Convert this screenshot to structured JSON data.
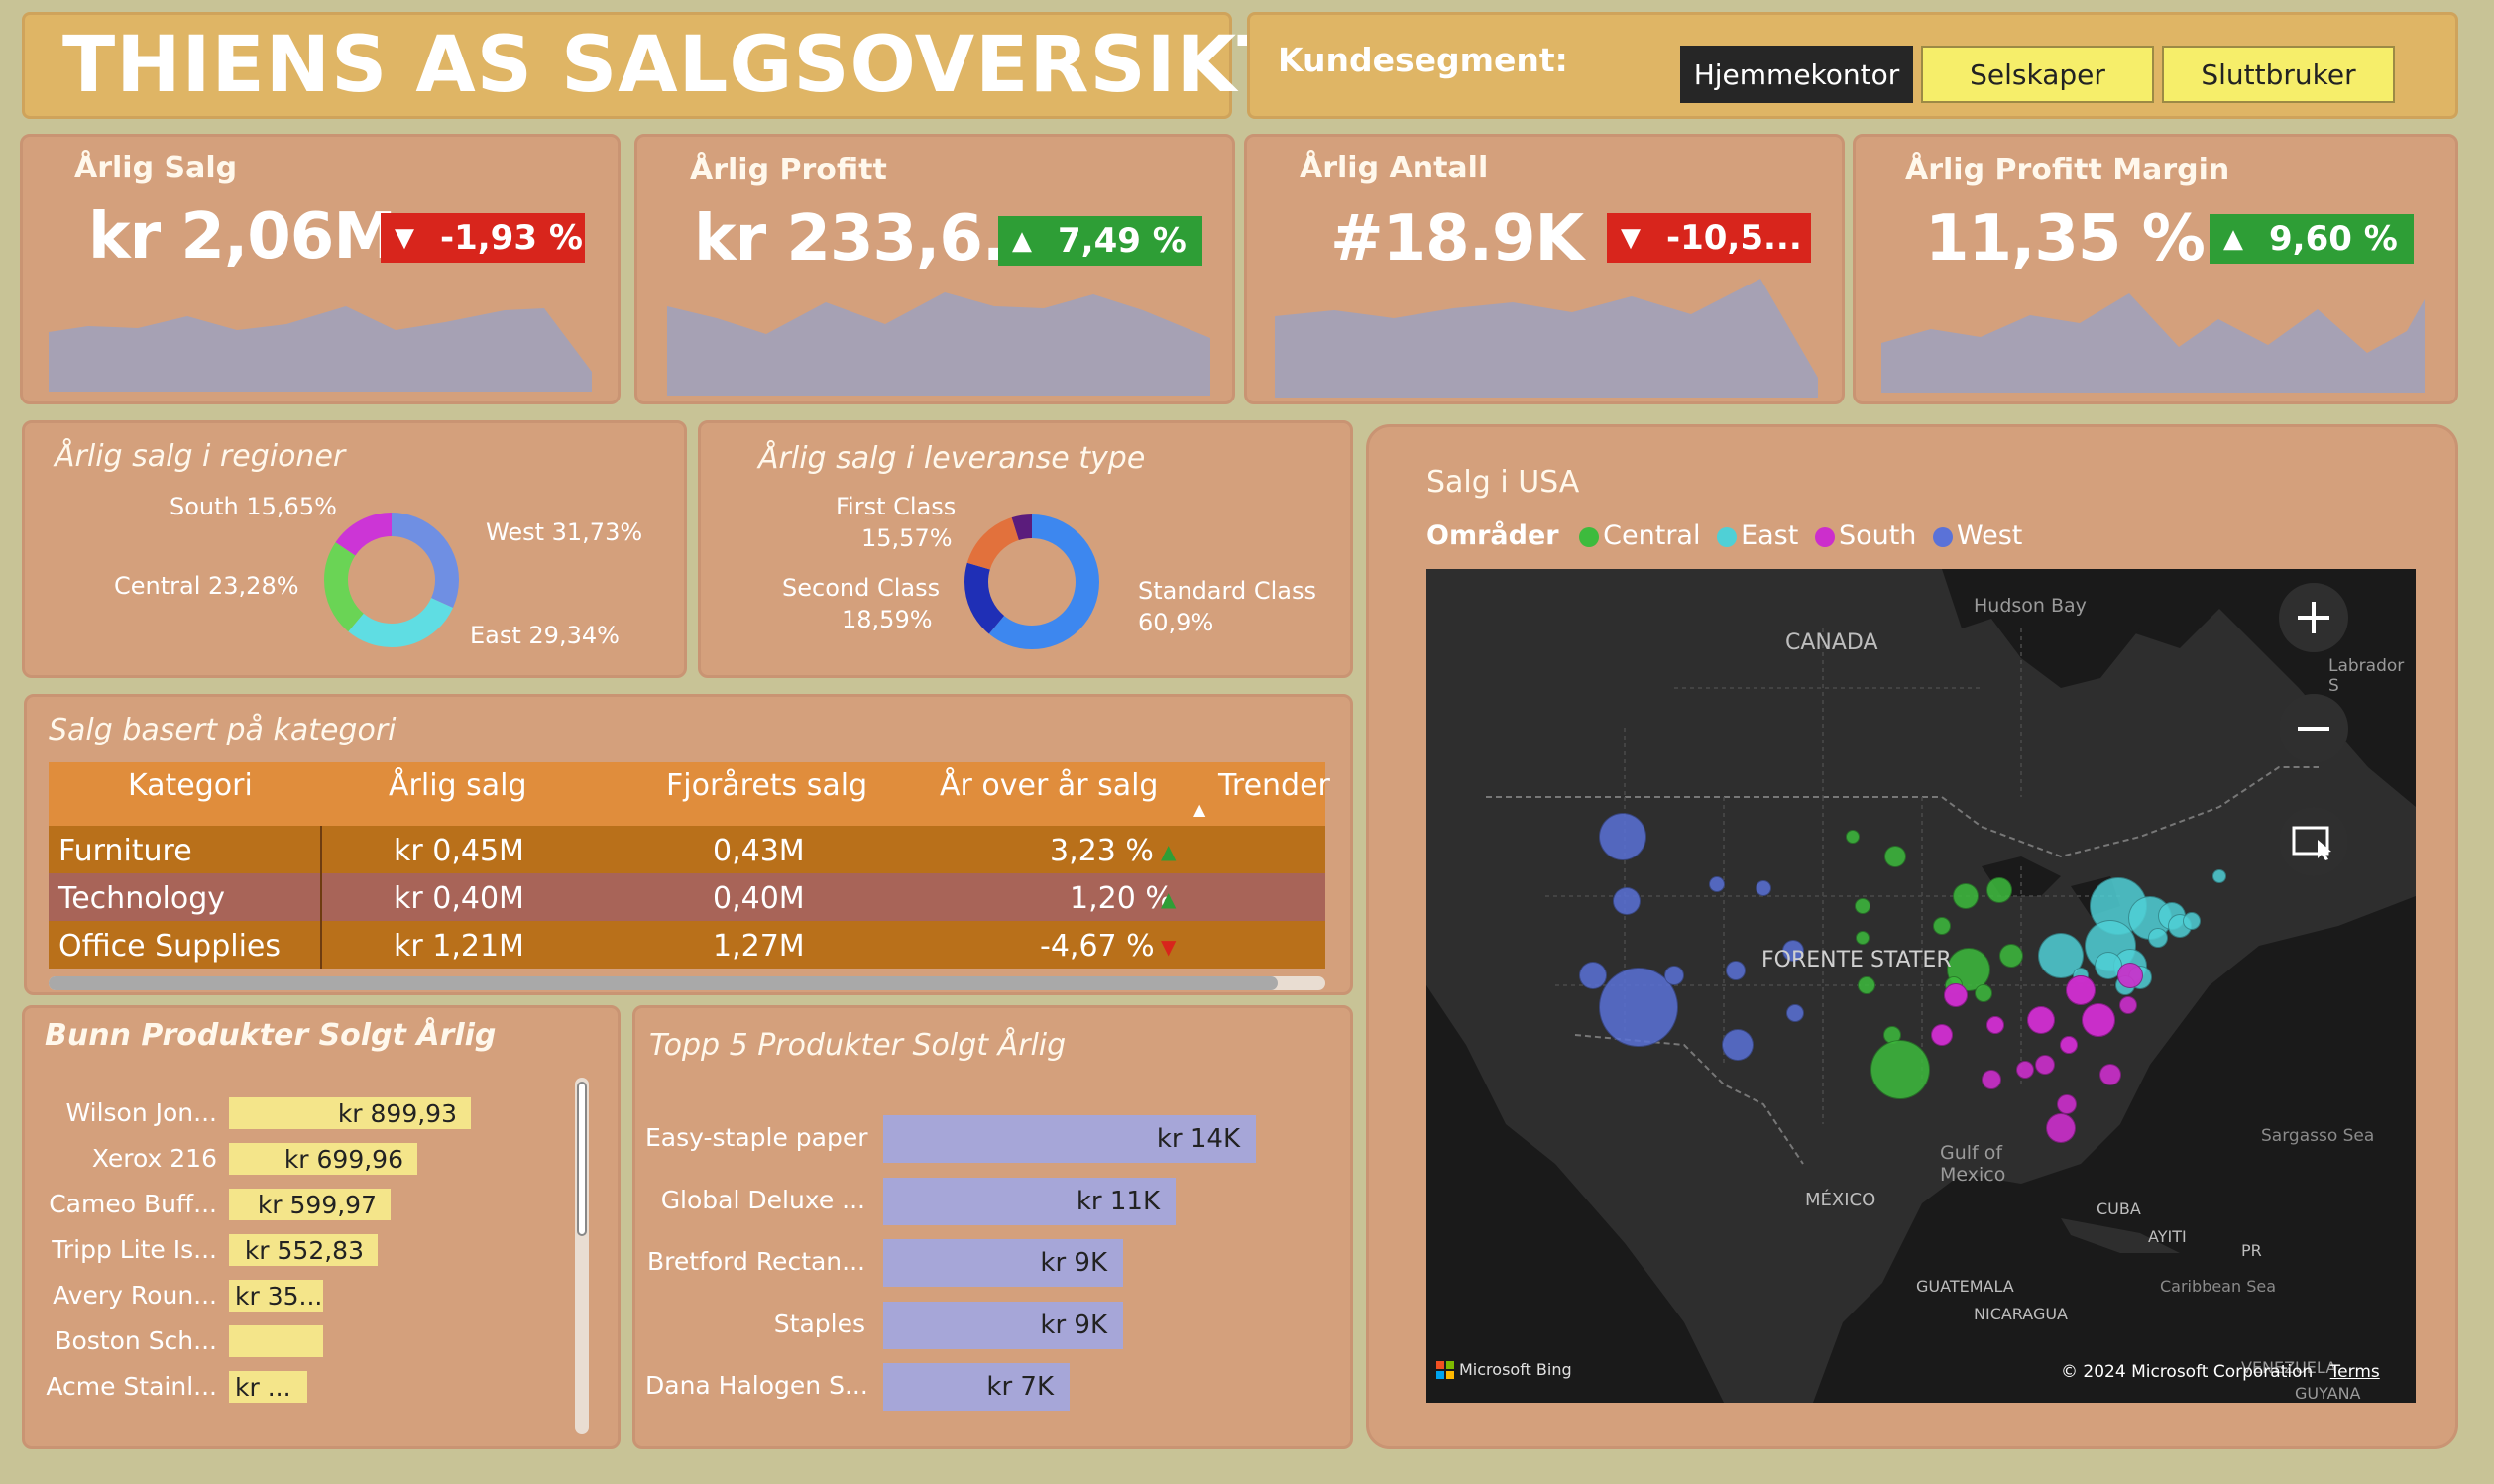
{
  "header": {
    "title": "THIENS AS SALGSOVERSIKT"
  },
  "segment": {
    "label": "Kundesegment:",
    "buttons": [
      "Hjemmekontor",
      "Selskaper",
      "Sluttbruker"
    ],
    "active": "Hjemmekontor"
  },
  "kpis": [
    {
      "title": "Årlig Salg",
      "value": "kr 2,06M",
      "change": "-1,93 %",
      "direction": "down"
    },
    {
      "title": "Årlig Profitt",
      "value": "kr 233,6...",
      "change": "7,49 %",
      "direction": "up"
    },
    {
      "title": "Årlig Antall",
      "value": "#18.9K",
      "change": "-10,5...",
      "direction": "down"
    },
    {
      "title": "Årlig Profitt Margin",
      "value": "11,35 %",
      "change": "9,60 %",
      "direction": "up"
    }
  ],
  "regions": {
    "title": "Årlig salg i regioner",
    "labels": [
      "South 15,65%",
      "West 31,73%",
      "Central 23,28%",
      "East 29,34%"
    ]
  },
  "shipping": {
    "title": "Årlig salg i leveranse type",
    "first_name": "First Class",
    "first_pct": "15,57%",
    "second_name": "Second Class",
    "second_pct": "18,59%",
    "standard_name": "Standard Class",
    "standard_pct": "60,9%"
  },
  "category_table": {
    "title": "Salg basert på kategori",
    "headers": [
      "Kategori",
      "Årlig salg",
      "Fjorårets salg",
      "År over år salg",
      "Trender"
    ],
    "rows": [
      {
        "category": "Furniture",
        "sales": "kr 0,45M",
        "last_year": "0,43M",
        "yoy": "3,23 %",
        "trend": "up"
      },
      {
        "category": "Technology",
        "sales": "kr 0,40M",
        "last_year": "0,40M",
        "yoy": "1,20 %",
        "trend": "up"
      },
      {
        "category": "Office Supplies",
        "sales": "kr 1,21M",
        "last_year": "1,27M",
        "yoy": "-4,67 %",
        "trend": "down"
      }
    ]
  },
  "bottom_products": {
    "title": "Bunn Produkter Solgt Årlig",
    "items": [
      {
        "name": "Wilson Jon...",
        "label": "kr 899,93",
        "value": 899.93
      },
      {
        "name": "Xerox 216",
        "label": "kr 699,96",
        "value": 699.96
      },
      {
        "name": "Cameo Buff...",
        "label": "kr 599,97",
        "value": 599.97
      },
      {
        "name": "Tripp Lite Is...",
        "label": "kr 552,83",
        "value": 552.83
      },
      {
        "name": "Avery Roun...",
        "label": "kr 35...",
        "value": 350
      },
      {
        "name": "Boston Sch...",
        "label": "",
        "value": 350
      },
      {
        "name": "Acme Stainl...",
        "label": "kr ...",
        "value": 290
      }
    ]
  },
  "top_products": {
    "title": "Topp 5 Produkter Solgt Årlig",
    "items": [
      {
        "name": "Easy-staple paper",
        "label": "kr 14K",
        "value": 14
      },
      {
        "name": "Global Deluxe ...",
        "label": "kr 11K",
        "value": 11
      },
      {
        "name": "Bretford Rectan...",
        "label": "kr 9K",
        "value": 9
      },
      {
        "name": "Staples",
        "label": "kr 9K",
        "value": 9
      },
      {
        "name": "Dana Halogen S...",
        "label": "kr 7K",
        "value": 7
      }
    ]
  },
  "map": {
    "title": "Salg i USA",
    "legend_title": "Områder",
    "legend": [
      {
        "name": "Central",
        "color": "#3dbb3d"
      },
      {
        "name": "East",
        "color": "#4fd0d6"
      },
      {
        "name": "South",
        "color": "#cc2ecc"
      },
      {
        "name": "West",
        "color": "#5a72d8"
      }
    ],
    "places": {
      "hudson": "Hudson Bay",
      "canada": "CANADA",
      "labrador": "Labrador S",
      "usa": "FORENTE STATER",
      "gulf": "Gulf of Mexico",
      "mexico": "MÉXICO",
      "sargasso": "Sargasso Sea",
      "cuba": "CUBA",
      "haiti": "AYITI",
      "pr": "PR",
      "guatemala": "GUATEMALA",
      "caribbean": "Caribbean Sea",
      "nicaragua": "NICARAGUA",
      "venezuela": "VENEZUELA",
      "guyana": "GUYANA"
    },
    "attribution": "Microsoft Bing",
    "copyright": "© 2024 Microsoft Corporation",
    "terms": "Terms"
  },
  "colors": {
    "panel": "#d4a07c",
    "header": "#dfb565",
    "down": "#d8251c",
    "up": "#2e9e36",
    "sparkline": "#a6a1b4",
    "table_header": "#e08d3c"
  }
}
